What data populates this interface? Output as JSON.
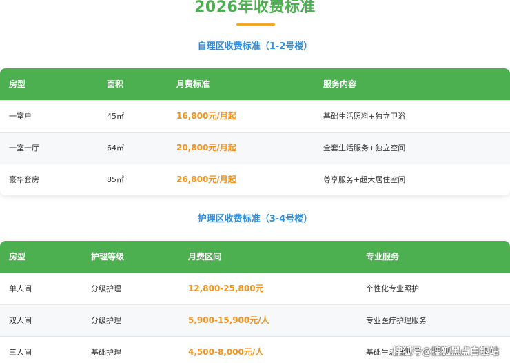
{
  "page_title": "2026年收费标准",
  "colors": {
    "green": "#4caf50",
    "orange": "#f5921e",
    "blue": "#2e8fe0",
    "underline": "#f5a623"
  },
  "self_care": {
    "heading": "自理区收费标准（1-2号楼）",
    "headers": [
      "房型",
      "面积",
      "月费标准",
      "服务内容"
    ],
    "rows": [
      {
        "room": "一室户",
        "area": "45㎡",
        "fee": "16,800元/月起",
        "service": "基础生活照料+独立卫浴"
      },
      {
        "room": "一室一厅",
        "area": "64㎡",
        "fee": "20,800元/月起",
        "service": "全套生活服务+独立空间"
      },
      {
        "room": "豪华套房",
        "area": "85㎡",
        "fee": "26,800元/月起",
        "service": "尊享服务+超大居住空间"
      }
    ]
  },
  "nursing": {
    "heading": "护理区收费标准（3-4号楼）",
    "headers": [
      "房型",
      "护理等级",
      "月费区间",
      "专业服务"
    ],
    "rows": [
      {
        "room": "单人间",
        "level": "分级护理",
        "fee": "12,800-25,800元",
        "service": "个性化专业照护"
      },
      {
        "room": "双人间",
        "level": "分级护理",
        "fee": "5,900-15,900元/人",
        "service": "专业医疗护理服务"
      },
      {
        "room": "三人间",
        "level": "基础护理",
        "fee": "4,500-8,000元/人",
        "service": "基础生活照料"
      }
    ]
  },
  "watermark": "搜狐号@搜狐黑点白银站"
}
